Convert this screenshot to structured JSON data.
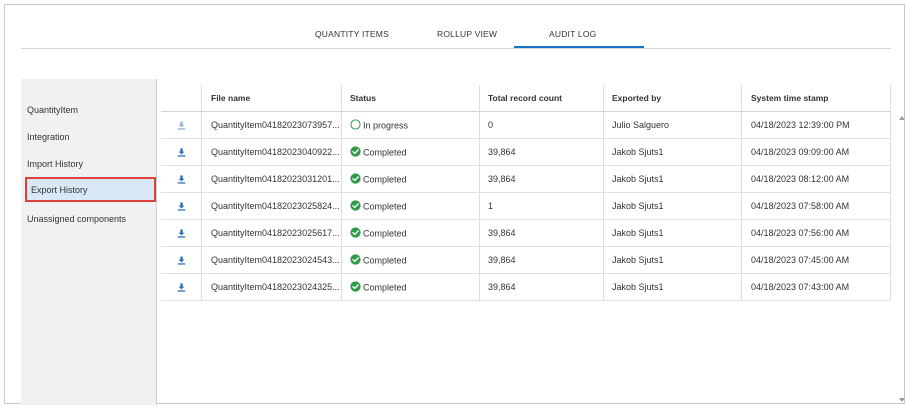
{
  "tabs": [
    {
      "label": "QUANTITY ITEMS",
      "active": false
    },
    {
      "label": "ROLLUP VIEW",
      "active": false
    },
    {
      "label": "AUDIT LOG",
      "active": true
    }
  ],
  "sidebar": {
    "items": [
      {
        "label": "QuantityItem"
      },
      {
        "label": "Integration"
      },
      {
        "label": "Import History"
      },
      {
        "label": "Export History",
        "selected": true
      },
      {
        "label": "Unassigned components"
      }
    ]
  },
  "table": {
    "columns": [
      "File name",
      "Status",
      "Total record count",
      "Exported by",
      "System time stamp"
    ],
    "rows": [
      {
        "file": "QuantityItem04182023073957...",
        "status": "In progress",
        "status_icon": "circle-outline-icon",
        "count": "0",
        "by": "Julio Salguero",
        "ts": "04/18/2023 12:39:00 PM"
      },
      {
        "file": "QuantityItem04182023040922...",
        "status": "Completed",
        "status_icon": "check-circle-icon",
        "count": "39,864",
        "by": "Jakob Sjuts1",
        "ts": "04/18/2023 09:09:00 AM"
      },
      {
        "file": "QuantityItem04182023031201...",
        "status": "Completed",
        "status_icon": "check-circle-icon",
        "count": "39,864",
        "by": "Jakob Sjuts1",
        "ts": "04/18/2023 08:12:00 AM"
      },
      {
        "file": "QuantityItem04182023025824...",
        "status": "Completed",
        "status_icon": "check-circle-icon",
        "count": "1",
        "by": "Jakob Sjuts1",
        "ts": "04/18/2023 07:58:00 AM"
      },
      {
        "file": "QuantityItem04182023025617...",
        "status": "Completed",
        "status_icon": "check-circle-icon",
        "count": "39,864",
        "by": "Jakob Sjuts1",
        "ts": "04/18/2023 07:56:00 AM"
      },
      {
        "file": "QuantityItem04182023024543...",
        "status": "Completed",
        "status_icon": "check-circle-icon",
        "count": "39,864",
        "by": "Jakob Sjuts1",
        "ts": "04/18/2023 07:45:00 AM"
      },
      {
        "file": "QuantityItem04182023024325...",
        "status": "Completed",
        "status_icon": "check-circle-icon",
        "count": "39,864",
        "by": "Jakob Sjuts1",
        "ts": "04/18/2023 07:43:00 AM"
      }
    ]
  },
  "colors": {
    "accent": "#1a73c8",
    "download_icon": "#2e6fb5",
    "download_icon_disabled": "#8fb3d9",
    "completed": "#2e9b47",
    "in_progress": "#2e9b47",
    "selected_bg": "#d9e8f6",
    "highlight_border": "#d9413a"
  }
}
